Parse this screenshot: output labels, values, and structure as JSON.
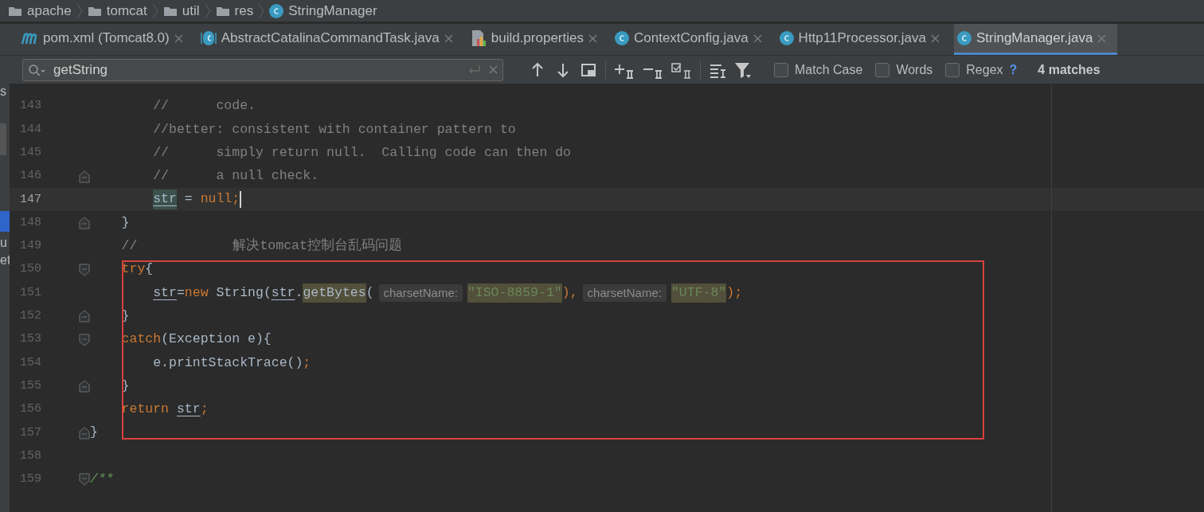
{
  "breadcrumbs": [
    {
      "label": "apache",
      "kind": "folder"
    },
    {
      "label": "tomcat",
      "kind": "folder"
    },
    {
      "label": "util",
      "kind": "folder"
    },
    {
      "label": "res",
      "kind": "folder"
    },
    {
      "label": "StringManager",
      "kind": "class"
    }
  ],
  "tabs": [
    {
      "label": "pom.xml (Tomcat8.0)",
      "kind": "maven",
      "selected": false
    },
    {
      "label": "AbstractCatalinaCommandTask.java",
      "kind": "abstract",
      "selected": false
    },
    {
      "label": "build.properties",
      "kind": "properties",
      "selected": false
    },
    {
      "label": "ContextConfig.java",
      "kind": "class",
      "selected": false
    },
    {
      "label": "Http11Processor.java",
      "kind": "class",
      "selected": false
    },
    {
      "label": "StringManager.java",
      "kind": "class",
      "selected": true
    }
  ],
  "search": {
    "value": "getString",
    "options": [
      {
        "label": "Match Case",
        "checked": false
      },
      {
        "label": "Words",
        "checked": false
      },
      {
        "label": "Regex",
        "checked": false
      }
    ],
    "help": "?",
    "matches": "4 matches"
  },
  "side_fragments": [
    "s",
    "u",
    "et"
  ],
  "lines": [
    {
      "number": "143",
      "current": false,
      "kind": "plain",
      "tokens": [
        {
          "text": "        //      code.",
          "kind": "comment"
        }
      ]
    },
    {
      "number": "144",
      "current": false,
      "kind": "plain",
      "tokens": [
        {
          "text": "        //better: consistent with container pattern to",
          "kind": "comment"
        }
      ]
    },
    {
      "number": "145",
      "current": false,
      "kind": "plain",
      "tokens": [
        {
          "text": "        //      simply return null.  Calling code can then do",
          "kind": "comment"
        }
      ]
    },
    {
      "number": "146",
      "current": false,
      "kind": "fold-end",
      "tokens": [
        {
          "text": "        //      a null check.",
          "kind": "comment"
        }
      ]
    },
    {
      "number": "147",
      "current": true,
      "kind": "plain",
      "tokens": [
        {
          "text": "        str",
          "kind": "var-match"
        },
        {
          "text": " = ",
          "kind": "plain"
        },
        {
          "text": "null;",
          "kind": "keyword"
        }
      ]
    },
    {
      "number": "148",
      "current": false,
      "kind": "fold-end",
      "tokens": [
        {
          "text": "    }",
          "kind": "plain"
        }
      ]
    },
    {
      "number": "149",
      "current": false,
      "kind": "plain",
      "tokens": [
        {
          "text": "    //",
          "kind": "comment"
        },
        {
          "text": "解决tomcat控制台乱码问题",
          "kind": "comment-far"
        }
      ]
    },
    {
      "number": "150",
      "current": false,
      "kind": "fold-start",
      "tokens": [
        {
          "text": "    try",
          "kind": "keyword"
        },
        {
          "text": "{",
          "kind": "plain"
        }
      ]
    },
    {
      "number": "151",
      "current": false,
      "kind": "plain",
      "tokens": [
        {
          "text": "        str",
          "kind": "var"
        },
        {
          "text": "=",
          "kind": "plain"
        },
        {
          "text": "new",
          "kind": "keyword"
        },
        {
          "text": " String(",
          "kind": "plain"
        },
        {
          "text": "str",
          "kind": "var"
        },
        {
          "text": ".",
          "kind": "plain"
        },
        {
          "text": "getBytes",
          "kind": "method-match"
        },
        {
          "text": "(",
          "kind": "plain"
        },
        {
          "text": "charsetName:",
          "kind": "hint"
        },
        {
          "text": "\"ISO-8859-1\"",
          "kind": "string-match"
        },
        {
          "text": "),",
          "kind": "keyword"
        },
        {
          "text": "charsetName:",
          "kind": "hint"
        },
        {
          "text": "\"UTF-8\"",
          "kind": "string-match"
        },
        {
          "text": ");",
          "kind": "keyword"
        }
      ]
    },
    {
      "number": "152",
      "current": false,
      "kind": "fold-end",
      "tokens": [
        {
          "text": "    }",
          "kind": "plain"
        }
      ]
    },
    {
      "number": "153",
      "current": false,
      "kind": "fold-start",
      "tokens": [
        {
          "text": "    catch",
          "kind": "keyword"
        },
        {
          "text": "(Exception e){",
          "kind": "plain"
        }
      ]
    },
    {
      "number": "154",
      "current": false,
      "kind": "plain",
      "tokens": [
        {
          "text": "        e.printStackTrace()",
          "kind": "plain"
        },
        {
          "text": ";",
          "kind": "keyword"
        }
      ]
    },
    {
      "number": "155",
      "current": false,
      "kind": "fold-end",
      "tokens": [
        {
          "text": "    }",
          "kind": "plain"
        }
      ]
    },
    {
      "number": "156",
      "current": false,
      "kind": "plain",
      "tokens": [
        {
          "text": "    return ",
          "kind": "keyword"
        },
        {
          "text": "str",
          "kind": "var"
        },
        {
          "text": ";",
          "kind": "keyword"
        }
      ]
    },
    {
      "number": "157",
      "current": false,
      "kind": "fold-end",
      "tokens": [
        {
          "text": "}",
          "kind": "plain"
        }
      ]
    },
    {
      "number": "158",
      "current": false,
      "kind": "plain"
    },
    {
      "number": "159",
      "current": false,
      "kind": "fold-start",
      "tokens": [
        {
          "text": "/**",
          "kind": "doc"
        }
      ]
    }
  ]
}
